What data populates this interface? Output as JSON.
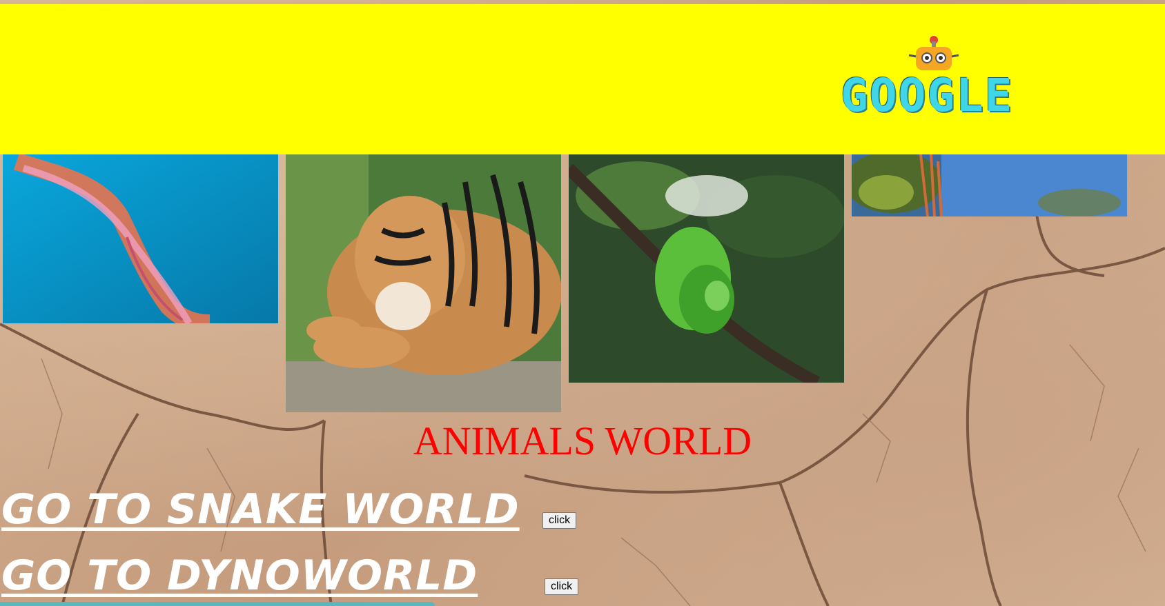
{
  "header": {
    "background": "#ffff00",
    "logo_text": "GOOGLE"
  },
  "gallery": [
    {
      "name": "jellyfish"
    },
    {
      "name": "tiger"
    },
    {
      "name": "snake"
    },
    {
      "name": "iguana"
    }
  ],
  "title": "ANIMALS WORLD",
  "links": {
    "snake": "GO TO SNAKE WORLD",
    "dyno": "GO TO DYNOWORLD"
  },
  "buttons": {
    "snake_click": "click",
    "dyno_click": "click"
  },
  "colors": {
    "title": "#ff0000",
    "link": "#ffffff",
    "footer_bar": "#5bb7bf"
  }
}
